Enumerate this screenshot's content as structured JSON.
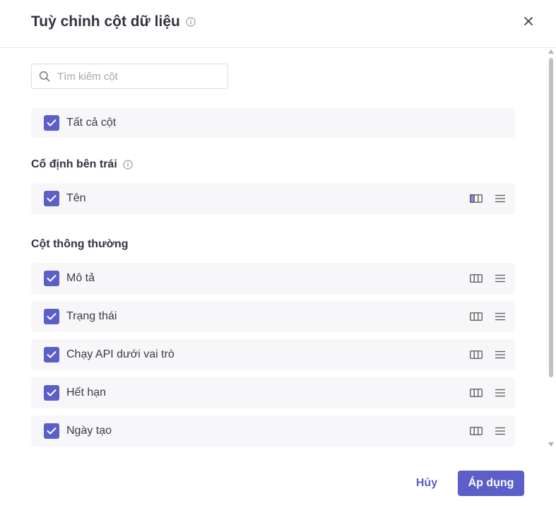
{
  "dialog": {
    "title": "Tuỳ chỉnh cột dữ liệu",
    "info_icon": "info-icon",
    "close_icon": "close-icon"
  },
  "search": {
    "placeholder": "Tìm kiếm cột",
    "value": ""
  },
  "all_columns": {
    "label": "Tất cả cột",
    "checked": true
  },
  "sections": {
    "pinned_left": {
      "title": "Cố định bên trái",
      "items": [
        {
          "label": "Tên",
          "checked": true
        }
      ]
    },
    "normal": {
      "title": "Cột thông thường",
      "items": [
        {
          "label": "Mô tả",
          "checked": true
        },
        {
          "label": "Trạng thái",
          "checked": true
        },
        {
          "label": "Chạy API dưới vai trò",
          "checked": true
        },
        {
          "label": "Hết hạn",
          "checked": true
        },
        {
          "label": "Ngày tạo",
          "checked": true
        }
      ]
    }
  },
  "footer": {
    "cancel_label": "Hủy",
    "apply_label": "Áp dụng"
  },
  "colors": {
    "accent": "#5b5fc7",
    "row_bg": "#f7f7f9"
  }
}
